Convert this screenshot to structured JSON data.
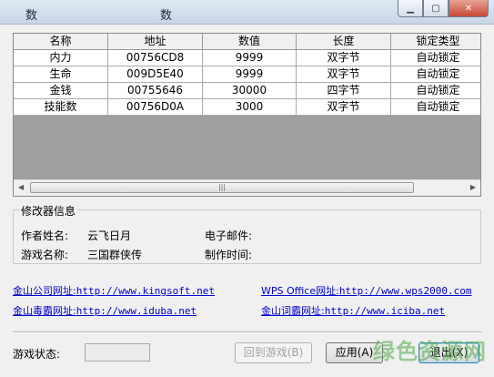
{
  "titlebar": {
    "text_left": "数",
    "text_right": "数"
  },
  "table": {
    "columns": [
      "名称",
      "地址",
      "数值",
      "长度",
      "锁定类型"
    ],
    "rows": [
      [
        "内力",
        "00756CD8",
        "9999",
        "双字节",
        "自动锁定"
      ],
      [
        "生命",
        "009D5E40",
        "9999",
        "双字节",
        "自动锁定"
      ],
      [
        "金钱",
        "00755646",
        "30000",
        "四字节",
        "自动锁定"
      ],
      [
        "技能数",
        "00756D0A",
        "3000",
        "双字节",
        "自动锁定"
      ]
    ]
  },
  "info": {
    "legend": "修改器信息",
    "author_label": "作者姓名:",
    "author_value": "云飞日月",
    "email_label": "电子邮件:",
    "game_label": "游戏名称:",
    "game_value": "三国群侠传",
    "time_label": "制作时间:"
  },
  "links": [
    {
      "name": "金山公司网址:",
      "url": "http://www.kingsoft.net"
    },
    {
      "name": "WPS Office网址:",
      "url": "http://www.wps2000.com"
    },
    {
      "name": "金山毒霸网址:",
      "url": "http://www.iduba.net"
    },
    {
      "name": "金山词霸网址:",
      "url": "http://www.iciba.net"
    }
  ],
  "status": {
    "label": "游戏状态:"
  },
  "buttons": {
    "back": "回到游戏(B)",
    "apply": "应用(A)",
    "exit": "退出(X)"
  },
  "watermark": "绿色资源网",
  "colors": {
    "link": "#0000cc",
    "grid_bg": "#a0a0a0",
    "watermark": "#4fa84b"
  }
}
